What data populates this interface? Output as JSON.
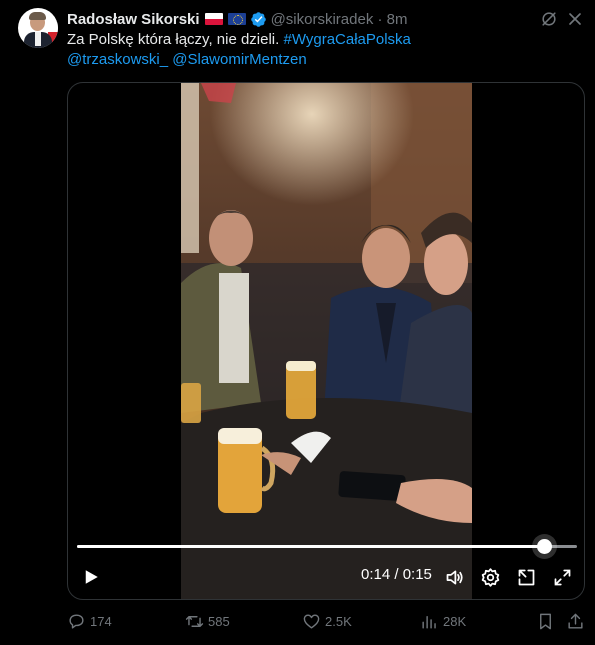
{
  "tweet": {
    "author_name": "Radosław Sikorski",
    "handle_time": "@sikorskiradek · 8m",
    "text_plain": "Za Polskę która łączy, nie dzieli. ",
    "hashtag": "#WygraCałaPolska",
    "mention_1": "@trzaskowski_",
    "mention_2": "@SlawomirMentzen"
  },
  "video": {
    "current_time": "0:14",
    "duration": "0:15",
    "time_display": "0:14 / 0:15",
    "progress_fraction": 0.933
  },
  "actions": {
    "replies": "174",
    "reposts": "585",
    "likes": "2.5K",
    "views": "28K"
  },
  "colors": {
    "accent": "#1d9bf0",
    "muted": "#71767b",
    "background": "#000000"
  },
  "icons": [
    "verified-badge-icon",
    "grok-icon",
    "more-icon",
    "play-icon",
    "volume-icon",
    "settings-icon",
    "pip-icon",
    "fullscreen-icon",
    "reply-icon",
    "repost-icon",
    "like-icon",
    "views-icon",
    "bookmark-icon",
    "share-icon"
  ]
}
